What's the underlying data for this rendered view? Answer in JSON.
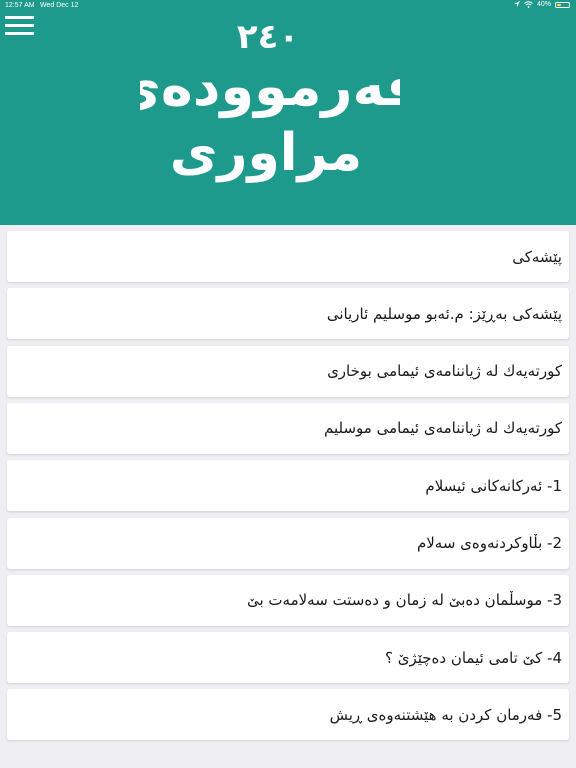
{
  "status_bar": {
    "time": "12:57 AM",
    "date": "Wed Dec 12",
    "battery": "40%",
    "battery_level": 0.4,
    "icons": [
      "location-icon",
      "wifi-icon",
      "battery-icon"
    ]
  },
  "header": {
    "background_color": "#1e9a8c",
    "menu_icon": "hamburger-menu-icon",
    "logo": {
      "number": "٢٤٠",
      "line1": "فەرموودەی",
      "line2": "مراوری"
    }
  },
  "list": {
    "items": [
      {
        "label": "پێشەکی"
      },
      {
        "label": "پێشەکی  بەڕێز: م.ئەبو موسلیم ئاریانی"
      },
      {
        "label": "کورتەیەك لە ژیاننامەی ئیمامی بوخاری"
      },
      {
        "label": "کورتەیەك لە ژیاننامەی ئیمامی موسلیم"
      },
      {
        "label": "1- ئەرکانەکانی ئیسلام"
      },
      {
        "label": "2- بڵاوکردنەوەی سەلام"
      },
      {
        "label": "3- موسڵمان دەبێ لە زمان و دەستت سەلامەت بێ"
      },
      {
        "label": "4- کێ تامی ئیمان دەچێژێ ؟"
      },
      {
        "label": "5- فەرمان کردن بە هێشتنەوەی ڕیش"
      }
    ]
  }
}
